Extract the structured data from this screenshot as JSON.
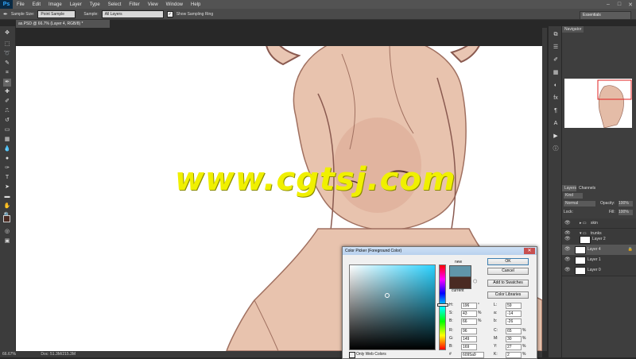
{
  "menu": {
    "logo": "Ps",
    "items": [
      "File",
      "Edit",
      "Image",
      "Layer",
      "Type",
      "Select",
      "Filter",
      "View",
      "Window",
      "Help"
    ]
  },
  "options": {
    "sample_size_label": "Sample Size:",
    "sample_size_value": "Point Sample",
    "sample_label": "Sample:",
    "sample_value": "All Layers",
    "show_ring_label": "Show Sampling Ring",
    "workspace": "Essentials"
  },
  "document": {
    "tab_title": "as.PSD @ 66.7% (Layer 4, RGB/8) *",
    "zoom": "66.67%",
    "doc_size": "Doc: 51.3M/215.3M"
  },
  "watermark": "www.cgtsj.com",
  "panels": {
    "navigator_tab": "Navigator",
    "layers_tab": "Layers",
    "channels_tab": "Channels",
    "kind_label": "Kind",
    "blend_mode": "Normal",
    "opacity_label": "Opacity:",
    "opacity_value": "100%",
    "lock_label": "Lock:",
    "fill_label": "Fill:",
    "fill_value": "100%",
    "layers": [
      {
        "name": "skin",
        "type": "group"
      },
      {
        "name": "trunks",
        "type": "group"
      },
      {
        "name": "Layer 2",
        "type": "layer"
      },
      {
        "name": "Layer 4",
        "type": "layer",
        "selected": true
      },
      {
        "name": "Layer 1",
        "type": "layer"
      },
      {
        "name": "Layer 0",
        "type": "layer"
      }
    ]
  },
  "color_picker": {
    "title": "Color Picker (Foreground Color)",
    "new_label": "new",
    "current_label": "current",
    "new_color": "#6095a9",
    "current_color": "#4a2a22",
    "ok": "OK",
    "cancel": "Cancel",
    "add_swatches": "Add to Swatches",
    "color_libraries": "Color Libraries",
    "only_web": "Only Web Colors",
    "fields_left": [
      {
        "label": "H:",
        "value": "196",
        "unit": "°"
      },
      {
        "label": "S:",
        "value": "43",
        "unit": "%"
      },
      {
        "label": "B:",
        "value": "66",
        "unit": "%"
      },
      {
        "label": "R:",
        "value": "96",
        "unit": ""
      },
      {
        "label": "G:",
        "value": "149",
        "unit": ""
      },
      {
        "label": "B:",
        "value": "169",
        "unit": ""
      },
      {
        "label": "#",
        "value": "6095a9",
        "unit": ""
      }
    ],
    "fields_right": [
      {
        "label": "L:",
        "value": "59",
        "unit": ""
      },
      {
        "label": "a:",
        "value": "-14",
        "unit": ""
      },
      {
        "label": "b:",
        "value": "-26",
        "unit": ""
      },
      {
        "label": "C:",
        "value": "65",
        "unit": "%"
      },
      {
        "label": "M:",
        "value": "30",
        "unit": "%"
      },
      {
        "label": "Y:",
        "value": "27",
        "unit": "%"
      },
      {
        "label": "K:",
        "value": "2",
        "unit": "%"
      }
    ]
  }
}
